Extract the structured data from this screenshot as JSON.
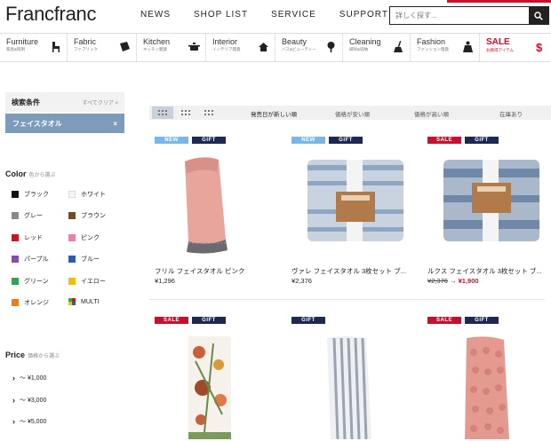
{
  "header": {
    "logo": "Francfranc",
    "nav": [
      "NEWS",
      "SHOP LIST",
      "SERVICE",
      "SUPPORT"
    ],
    "search_placeholder": "詳しく探す..."
  },
  "categories": [
    {
      "en": "Furniture",
      "jp": "家具&照明",
      "icon": "chair-icon"
    },
    {
      "en": "Fabric",
      "jp": "ファブリック",
      "icon": "fabric-icon"
    },
    {
      "en": "Kitchen",
      "jp": "キッチン雑貨",
      "icon": "pot-icon"
    },
    {
      "en": "Interior",
      "jp": "インテリア雑貨",
      "icon": "house-icon"
    },
    {
      "en": "Beauty",
      "jp": "バス&ビューティー",
      "icon": "mirror-icon"
    },
    {
      "en": "Cleaning",
      "jp": "掃除&収納",
      "icon": "broom-icon"
    },
    {
      "en": "Fashion",
      "jp": "ファッション雑貨",
      "icon": "person-icon"
    },
    {
      "en": "SALE",
      "jp": "お買得アイテム",
      "icon": "dollar-icon"
    }
  ],
  "sidebar": {
    "conditions_title": "検索条件",
    "clear_all": "すべてクリア ×",
    "active_filter": "フェイスタオル",
    "color_title": "Color",
    "color_sub": "色から選ぶ",
    "colors": [
      {
        "name": "ブラック",
        "hex": "#111111"
      },
      {
        "name": "ホワイト",
        "hex": "#f4f4f4"
      },
      {
        "name": "グレー",
        "hex": "#8a8a8a"
      },
      {
        "name": "ブラウン",
        "hex": "#7a4a1f"
      },
      {
        "name": "レッド",
        "hex": "#d8101e"
      },
      {
        "name": "ピンク",
        "hex": "#f07aa8"
      },
      {
        "name": "パープル",
        "hex": "#8a4ab0"
      },
      {
        "name": "ブルー",
        "hex": "#2a5ab8"
      },
      {
        "name": "グリーン",
        "hex": "#2aa84a"
      },
      {
        "name": "イエロー",
        "hex": "#f0c000"
      },
      {
        "name": "オレンジ",
        "hex": "#f07a1a"
      },
      {
        "name": "MULTI",
        "hex": "multi"
      }
    ],
    "price_title": "Price",
    "price_sub": "価格から選ぶ",
    "prices": [
      "～ ¥1,000",
      "～ ¥3,000",
      "～ ¥5,000"
    ]
  },
  "sort": {
    "options": [
      "発売日が新しい順",
      "価格が安い順",
      "価格が高い順",
      "在庫あり"
    ]
  },
  "products": [
    {
      "badges": [
        "NEW",
        "GIFT"
      ],
      "name": "フリル フェイスタオル ピンク",
      "price": "¥1,296",
      "old_price": "",
      "sale_price": ""
    },
    {
      "badges": [
        "NEW",
        "GIFT"
      ],
      "name": "ヴァレ フェイスタオル 3枚セット ブ...",
      "price": "¥2,376",
      "old_price": "",
      "sale_price": ""
    },
    {
      "badges": [
        "SALE",
        "GIFT"
      ],
      "name": "ルクス フェイスタオル 3枚セット ブ...",
      "price": "",
      "old_price": "¥2,376",
      "sale_price": "¥1,900"
    },
    {
      "badges": [
        "SALE",
        "GIFT"
      ],
      "name": "",
      "price": "",
      "old_price": "",
      "sale_price": ""
    },
    {
      "badges": [
        "GIFT"
      ],
      "name": "",
      "price": "",
      "old_price": "",
      "sale_price": ""
    },
    {
      "badges": [
        "SALE",
        "GIFT"
      ],
      "name": "",
      "price": "",
      "old_price": "",
      "sale_price": ""
    }
  ]
}
